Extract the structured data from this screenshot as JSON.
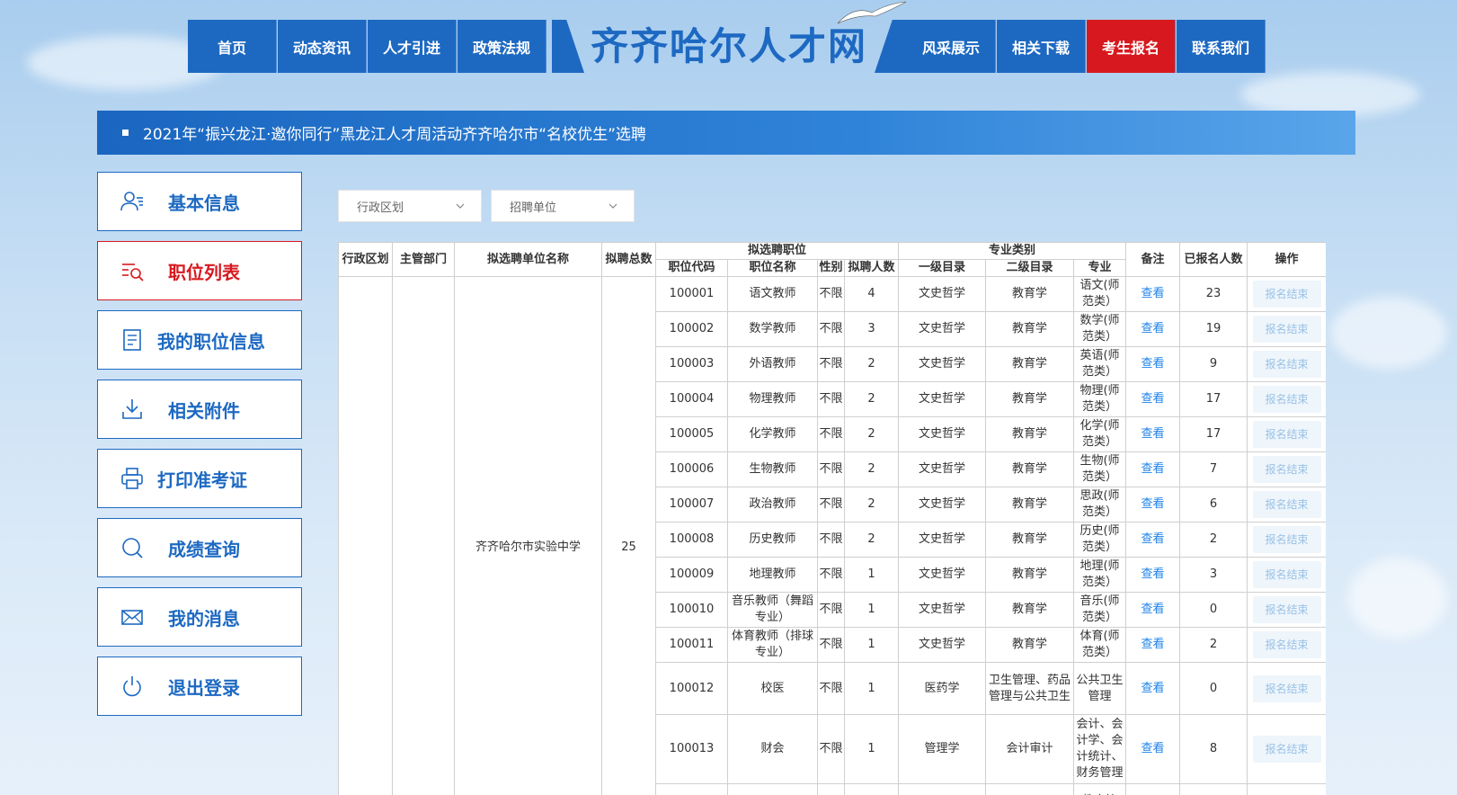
{
  "site": {
    "title": "齐齐哈尔人才网"
  },
  "nav": [
    {
      "label": "首页",
      "active": false
    },
    {
      "label": "动态资讯",
      "active": false
    },
    {
      "label": "人才引进",
      "active": false
    },
    {
      "label": "政策法规",
      "active": false
    },
    {
      "label": "风采展示",
      "active": false
    },
    {
      "label": "相关下载",
      "active": false
    },
    {
      "label": "考生报名",
      "active": true
    },
    {
      "label": "联系我们",
      "active": false
    }
  ],
  "banner": {
    "text": "2021年“振兴龙江·邀你同行”黑龙江人才周活动齐齐哈尔市“名校优生”选聘"
  },
  "sidebar": [
    {
      "label": "基本信息",
      "icon": "user-icon"
    },
    {
      "label": "职位列表",
      "icon": "list-search-icon",
      "active": true
    },
    {
      "label": "我的职位信息",
      "icon": "document-icon"
    },
    {
      "label": "相关附件",
      "icon": "download-icon"
    },
    {
      "label": "打印准考证",
      "icon": "printer-icon"
    },
    {
      "label": "成绩查询",
      "icon": "search-icon"
    },
    {
      "label": "我的消息",
      "icon": "mail-icon"
    },
    {
      "label": "退出登录",
      "icon": "power-icon"
    }
  ],
  "filters": {
    "region": "行政区划",
    "unit": "招聘单位"
  },
  "table": {
    "headers": {
      "region": "行政区划",
      "dept": "主管部门",
      "unit_name": "拟选聘单位名称",
      "total": "拟聘总数",
      "position_group": "拟选聘职位",
      "code": "职位代码",
      "pos_name": "职位名称",
      "gender": "性别",
      "count": "拟聘人数",
      "major_group": "专业类别",
      "level1": "一级目录",
      "level2": "二级目录",
      "major": "专业",
      "note": "备注",
      "applied": "已报名人数",
      "action": "操作"
    },
    "unit": {
      "region": "",
      "dept": "",
      "name": "齐齐哈尔市实验中学",
      "total": "25"
    },
    "view_label": "查看",
    "end_label": "报名结束",
    "rows": [
      {
        "code": "100001",
        "name": "语文教师",
        "gender": "不限",
        "count": "4",
        "l1": "文史哲学",
        "l2": "教育学",
        "major": "语文(师范类）",
        "applied": "23"
      },
      {
        "code": "100002",
        "name": "数学教师",
        "gender": "不限",
        "count": "3",
        "l1": "文史哲学",
        "l2": "教育学",
        "major": "数学(师范类）",
        "applied": "19"
      },
      {
        "code": "100003",
        "name": "外语教师",
        "gender": "不限",
        "count": "2",
        "l1": "文史哲学",
        "l2": "教育学",
        "major": "英语(师范类）",
        "applied": "9"
      },
      {
        "code": "100004",
        "name": "物理教师",
        "gender": "不限",
        "count": "2",
        "l1": "文史哲学",
        "l2": "教育学",
        "major": "物理(师范类）",
        "applied": "17"
      },
      {
        "code": "100005",
        "name": "化学教师",
        "gender": "不限",
        "count": "2",
        "l1": "文史哲学",
        "l2": "教育学",
        "major": "化学(师范类）",
        "applied": "17"
      },
      {
        "code": "100006",
        "name": "生物教师",
        "gender": "不限",
        "count": "2",
        "l1": "文史哲学",
        "l2": "教育学",
        "major": "生物(师范类）",
        "applied": "7"
      },
      {
        "code": "100007",
        "name": "政治教师",
        "gender": "不限",
        "count": "2",
        "l1": "文史哲学",
        "l2": "教育学",
        "major": "思政(师范类）",
        "applied": "6"
      },
      {
        "code": "100008",
        "name": "历史教师",
        "gender": "不限",
        "count": "2",
        "l1": "文史哲学",
        "l2": "教育学",
        "major": "历史(师范类）",
        "applied": "2"
      },
      {
        "code": "100009",
        "name": "地理教师",
        "gender": "不限",
        "count": "1",
        "l1": "文史哲学",
        "l2": "教育学",
        "major": "地理(师范类）",
        "applied": "3"
      },
      {
        "code": "100010",
        "name": "音乐教师（舞蹈专业）",
        "gender": "不限",
        "count": "1",
        "l1": "文史哲学",
        "l2": "教育学",
        "major": "音乐(师范类）",
        "applied": "0"
      },
      {
        "code": "100011",
        "name": "体育教师（排球专业）",
        "gender": "不限",
        "count": "1",
        "l1": "文史哲学",
        "l2": "教育学",
        "major": "体育(师范类）",
        "applied": "2"
      },
      {
        "code": "100012",
        "name": "校医",
        "gender": "不限",
        "count": "1",
        "l1": "医药学",
        "l2": "卫生管理、药品管理与公共卫生",
        "major": "公共卫生管理",
        "applied": "0"
      },
      {
        "code": "100013",
        "name": "财会",
        "gender": "不限",
        "count": "1",
        "l1": "管理学",
        "l2": "会计审计",
        "major": "会计、会计学、会计统计、财务管理",
        "applied": "8"
      },
      {
        "code": "",
        "name": "",
        "gender": "",
        "count": "",
        "l1": "",
        "l2": "",
        "major": "教育管",
        "applied": ""
      }
    ]
  }
}
